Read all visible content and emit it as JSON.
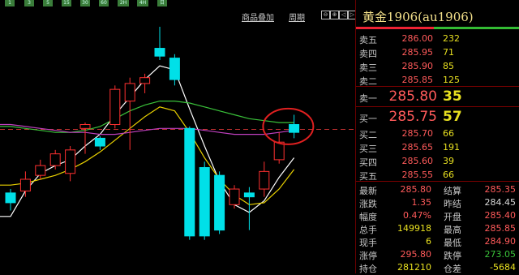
{
  "toolbar": {
    "buttons": [
      "1",
      "3",
      "5",
      "15",
      "30",
      "60",
      "2H",
      "4H",
      "日"
    ]
  },
  "chart_header": {
    "overlay_label": "商品叠加",
    "period_label": "周期",
    "controls": [
      "⊖",
      "⊕",
      "◁",
      "▷"
    ]
  },
  "chart_data": {
    "type": "candlestick",
    "candles": [
      {
        "open": 282.2,
        "close": 281.7,
        "high": 282.4,
        "low": 281.3
      },
      {
        "open": 282.3,
        "close": 282.9,
        "high": 283.3,
        "low": 282.0
      },
      {
        "open": 283.1,
        "close": 283.6,
        "high": 283.9,
        "low": 282.9
      },
      {
        "open": 283.6,
        "close": 284.2,
        "high": 284.4,
        "low": 283.4
      },
      {
        "open": 283.2,
        "close": 284.4,
        "high": 284.6,
        "low": 282.8
      },
      {
        "open": 285.5,
        "close": 285.7,
        "high": 285.8,
        "low": 284.2
      },
      {
        "open": 285.0,
        "close": 284.6,
        "high": 285.1,
        "low": 284.4
      },
      {
        "open": 285.7,
        "close": 287.5,
        "high": 287.7,
        "low": 285.5
      },
      {
        "open": 286.9,
        "close": 287.8,
        "high": 288.1,
        "low": 284.4
      },
      {
        "open": 287.8,
        "close": 288.1,
        "high": 288.3,
        "low": 287.3
      },
      {
        "open": 289.6,
        "close": 289.2,
        "high": 290.7,
        "low": 289.0
      },
      {
        "open": 289.1,
        "close": 288.0,
        "high": 289.3,
        "low": 287.7
      },
      {
        "open": 285.5,
        "close": 280.0,
        "high": 285.6,
        "low": 279.8
      },
      {
        "open": 283.5,
        "close": 280.0,
        "high": 283.8,
        "low": 279.8
      },
      {
        "open": 283.1,
        "close": 280.3,
        "high": 283.3,
        "low": 280.1
      },
      {
        "open": 281.6,
        "close": 282.4,
        "high": 282.6,
        "low": 281.4
      },
      {
        "open": 282.2,
        "close": 282.0,
        "high": 282.5,
        "low": 280.3
      },
      {
        "open": 282.4,
        "close": 283.3,
        "high": 283.8,
        "low": 282.0
      },
      {
        "open": 283.9,
        "close": 284.8,
        "high": 285.3,
        "low": 283.7
      },
      {
        "open": 285.7,
        "close": 285.3,
        "high": 286.2,
        "low": 285.0
      }
    ],
    "moving_averages": [
      {
        "color": "#ffffff",
        "values": [
          281.0,
          282.3,
          283.2,
          283.6,
          283.9,
          284.6,
          285.2,
          286.2,
          287.1,
          288.0,
          288.7,
          288.5,
          286.5,
          284.6,
          282.8,
          281.6,
          281.2,
          281.8,
          283.0,
          284.0
        ]
      },
      {
        "color": "#e8d000",
        "values": [
          282.6,
          282.7,
          282.9,
          283.1,
          283.4,
          283.8,
          284.3,
          284.9,
          285.5,
          286.1,
          286.6,
          286.4,
          285.3,
          284.0,
          282.9,
          282.1,
          281.6,
          281.7,
          282.4,
          283.4
        ]
      },
      {
        "color": "#3ac23a",
        "values": [
          285.6,
          285.5,
          285.4,
          285.3,
          285.3,
          285.4,
          285.6,
          286.0,
          286.4,
          286.7,
          286.9,
          286.9,
          286.8,
          286.6,
          286.4,
          286.2,
          286.0,
          285.9,
          285.8,
          285.8
        ]
      },
      {
        "color": "#c040c0",
        "values": [
          285.7,
          285.6,
          285.5,
          285.4,
          285.3,
          285.3,
          285.2,
          285.2,
          285.3,
          285.4,
          285.5,
          285.5,
          285.5,
          285.4,
          285.3,
          285.2,
          285.2,
          285.2,
          285.3,
          285.4
        ]
      }
    ],
    "reference_price": 285.45,
    "ylim": [
      278.5,
      291.2
    ],
    "annotation": "red-circle-on-last-candles"
  },
  "quote": {
    "title": "黄金1906(au1906)",
    "asks": [
      {
        "label": "卖五",
        "price": "286.00",
        "vol": "232"
      },
      {
        "label": "卖四",
        "price": "285.95",
        "vol": "71"
      },
      {
        "label": "卖三",
        "price": "285.90",
        "vol": "85"
      },
      {
        "label": "卖二",
        "price": "285.85",
        "vol": "125"
      }
    ],
    "ask1": {
      "label": "卖一",
      "price": "285.80",
      "vol": "35"
    },
    "bid1": {
      "label": "买一",
      "price": "285.75",
      "vol": "57"
    },
    "bids": [
      {
        "label": "买二",
        "price": "285.70",
        "vol": "66"
      },
      {
        "label": "买三",
        "price": "285.65",
        "vol": "191"
      },
      {
        "label": "买四",
        "price": "285.60",
        "vol": "39"
      },
      {
        "label": "买五",
        "price": "285.55",
        "vol": "66"
      }
    ],
    "stats": [
      {
        "l1": "最新",
        "v1": "285.80",
        "c1": "#ff5a5a",
        "l2": "结算",
        "v2": "285.35",
        "c2": "#ff5a5a"
      },
      {
        "l1": "涨跌",
        "v1": "1.35",
        "c1": "#ff5a5a",
        "l2": "昨结",
        "v2": "284.45",
        "c2": "#d8d8d8"
      },
      {
        "l1": "幅度",
        "v1": "0.47%",
        "c1": "#ff5a5a",
        "l2": "开盘",
        "v2": "285.40",
        "c2": "#ff5a5a"
      },
      {
        "l1": "总手",
        "v1": "149918",
        "c1": "#e8e020",
        "l2": "最高",
        "v2": "285.85",
        "c2": "#ff5a5a"
      },
      {
        "l1": "现手",
        "v1": "6",
        "c1": "#e8e020",
        "l2": "最低",
        "v2": "284.90",
        "c2": "#ff5a5a"
      },
      {
        "l1": "涨停",
        "v1": "295.80",
        "c1": "#ff5a5a",
        "l2": "跌停",
        "v2": "273.05",
        "c2": "#3ac23a"
      },
      {
        "l1": "持仓",
        "v1": "281210",
        "c1": "#e8e020",
        "l2": "仓差",
        "v2": "-5684",
        "c2": "#e8e020"
      }
    ]
  }
}
